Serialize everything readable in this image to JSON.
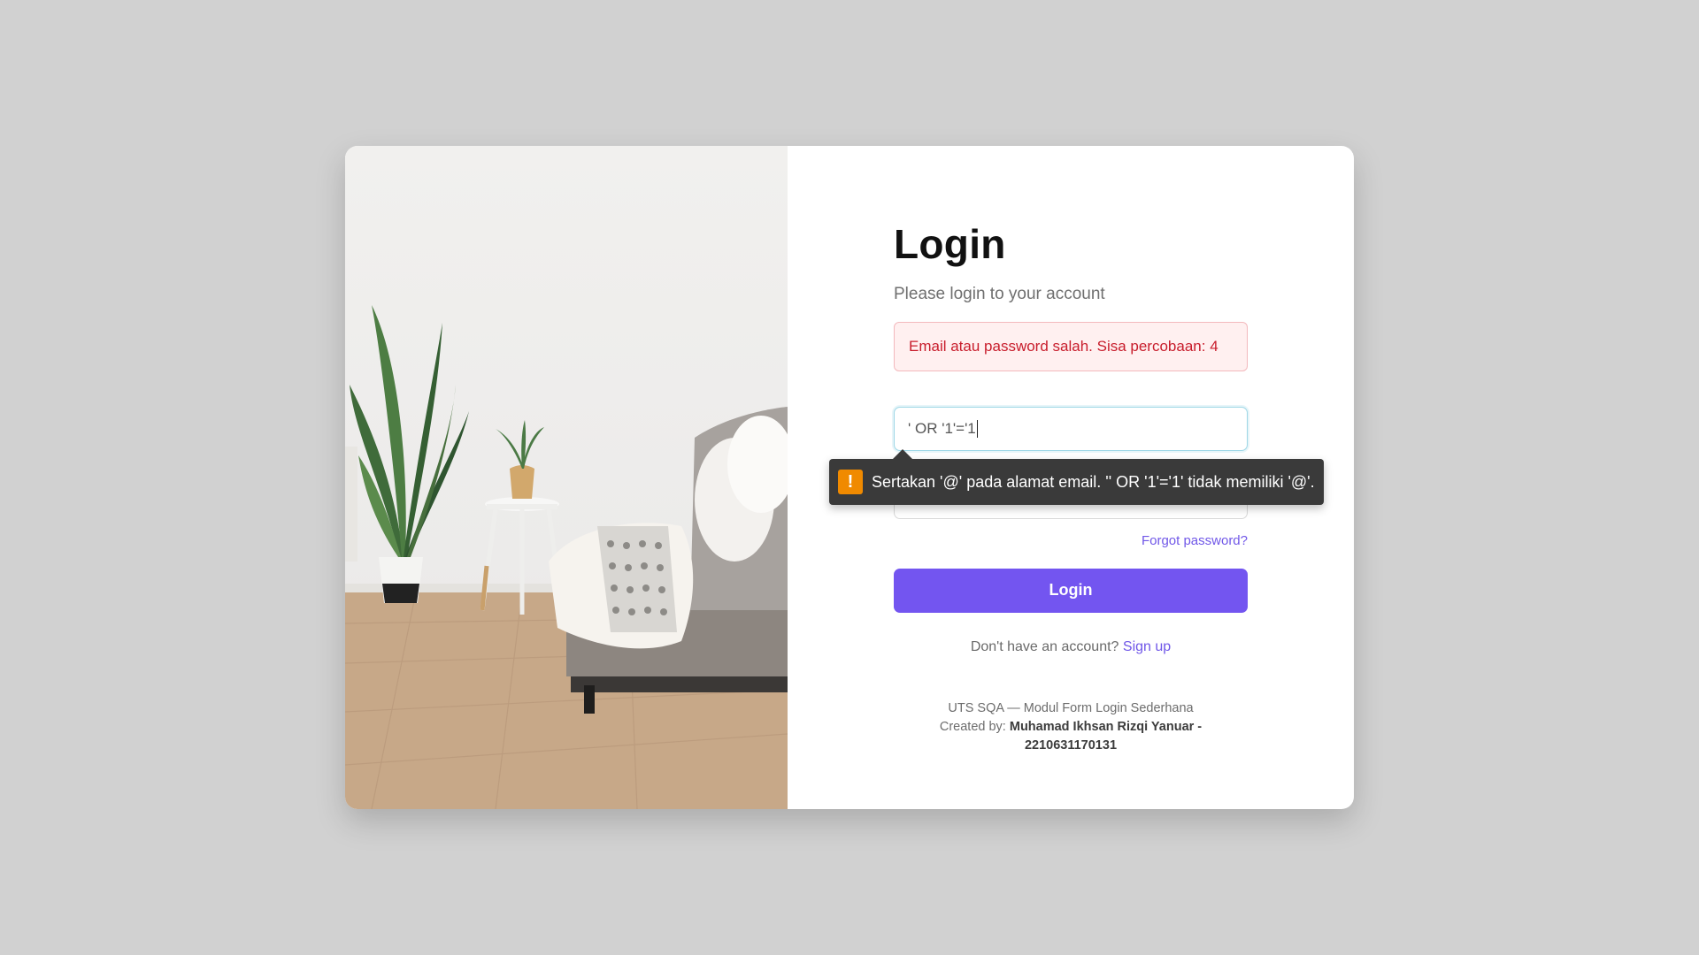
{
  "login": {
    "title": "Login",
    "subtitle": "Please login to your account",
    "error_message": "Email atau password salah. Sisa percobaan: 4",
    "email_value": "' OR '1'='1",
    "validation_tooltip": "Sertakan '@' pada alamat email. '' OR '1'='1' tidak memiliki '@'.",
    "forgot_password": "Forgot password?",
    "login_button": "Login",
    "signup_prompt": "Don't have an account?",
    "signup_link": "Sign up"
  },
  "footer": {
    "course_line": "UTS SQA — Modul Form Login Sederhana",
    "created_by_label": "Created by:",
    "author": "Muhamad Ikhsan Rizqi Yanuar - 2210631170131"
  },
  "icons": {
    "tooltip_icon": "warning-icon",
    "tooltip_icon_glyph": "!"
  },
  "colors": {
    "accent": "#7355f0",
    "error_text": "#c81d2c",
    "error_bg": "#fff0f0",
    "warning": "#f08a00",
    "background": "#d1d1d1"
  }
}
